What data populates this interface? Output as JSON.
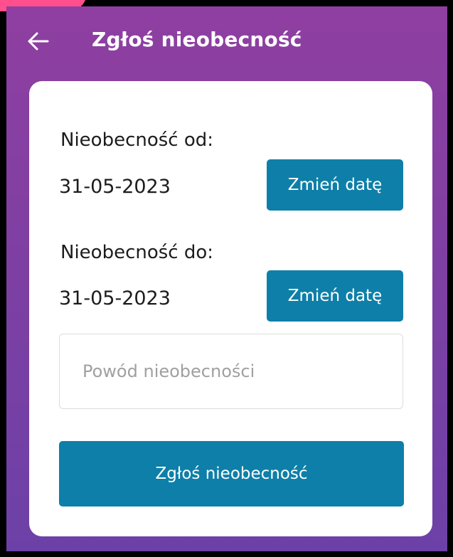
{
  "appbar": {
    "title": "Zgłoś nieobecność",
    "back_icon": "arrow-left-icon"
  },
  "form": {
    "from": {
      "label": "Nieobecność od:",
      "date": "31-05-2023",
      "button_label": "Zmień datę"
    },
    "to": {
      "label": "Nieobecność do:",
      "date": "31-05-2023",
      "button_label": "Zmień datę"
    },
    "reason": {
      "value": "",
      "placeholder": "Powód nieobecności"
    },
    "submit_label": "Zgłoś nieobecność"
  },
  "colors": {
    "accent": "#0e7fa8",
    "background_top": "#8f3fa1",
    "background_bottom": "#6c41a7",
    "card": "#ffffff"
  }
}
